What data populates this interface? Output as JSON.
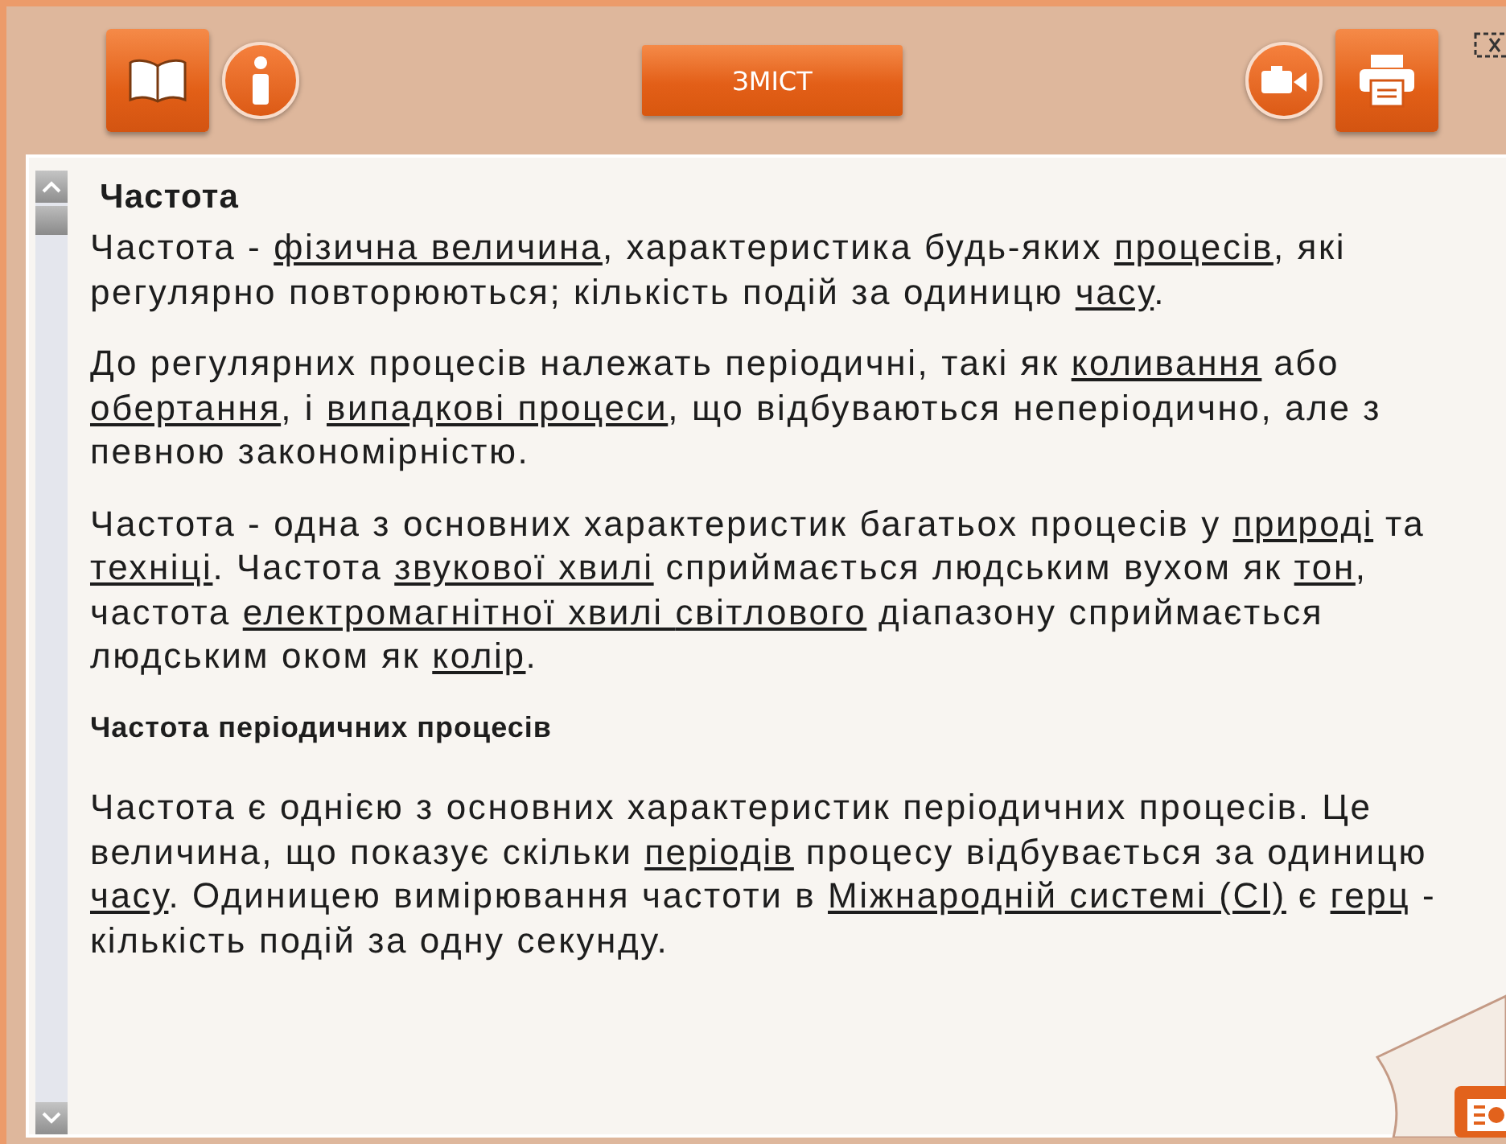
{
  "toolbar": {
    "contents_button": "ЗМІСТ"
  },
  "article": {
    "title": "Частота",
    "blocks": [
      {
        "kind": "paragraph",
        "segments": [
          {
            "kind": "text",
            "text": "Частота - "
          },
          {
            "kind": "link",
            "text": "фізична величина"
          },
          {
            "kind": "text",
            "text": ", характеристика будь-яких "
          },
          {
            "kind": "link",
            "text": "процесів"
          },
          {
            "kind": "text",
            "text": ", які регулярно повторюються; кількість подій за одиницю "
          },
          {
            "kind": "link",
            "text": "часу"
          },
          {
            "kind": "text",
            "text": "."
          }
        ]
      },
      {
        "kind": "paragraph",
        "segments": [
          {
            "kind": "text",
            "text": "До регулярних процесів належать періодичні, такі як "
          },
          {
            "kind": "link",
            "text": "коливання"
          },
          {
            "kind": "text",
            "text": " або "
          },
          {
            "kind": "link",
            "text": "обертання"
          },
          {
            "kind": "text",
            "text": ", і "
          },
          {
            "kind": "link",
            "text": "випадкові процеси"
          },
          {
            "kind": "text",
            "text": ", що відбуваються неперіодично, але з певною закономірністю."
          }
        ]
      },
      {
        "kind": "paragraph",
        "segments": [
          {
            "kind": "text",
            "text": "Частота - одна з основних характеристик багатьох процесів у "
          },
          {
            "kind": "link",
            "text": "природі"
          },
          {
            "kind": "text",
            "text": " та "
          },
          {
            "kind": "link",
            "text": "техніці"
          },
          {
            "kind": "text",
            "text": ". Частота "
          },
          {
            "kind": "link",
            "text": "звукової хвилі"
          },
          {
            "kind": "text",
            "text": " сприймається людським вухом як "
          },
          {
            "kind": "link",
            "text": "тон"
          },
          {
            "kind": "text",
            "text": ", частота "
          },
          {
            "kind": "link",
            "text": "електромагнітної хвилі "
          },
          {
            "kind": "link",
            "text": "світлового"
          },
          {
            "kind": "text",
            "text": " діапазону сприймається людським оком як "
          },
          {
            "kind": "link",
            "text": "колір"
          },
          {
            "kind": "text",
            "text": "."
          }
        ]
      },
      {
        "kind": "heading",
        "segments": [
          {
            "kind": "text",
            "text": "Частота періодичних процесів"
          }
        ]
      },
      {
        "kind": "paragraph",
        "segments": [
          {
            "kind": "text",
            "text": "Частота є однією з основних характеристик періодичних процесів. Це величина, що показує скільки "
          },
          {
            "kind": "link",
            "text": "періодів"
          },
          {
            "kind": "text",
            "text": " процесу відбувається за одиницю "
          },
          {
            "kind": "link",
            "text": "часу"
          },
          {
            "kind": "text",
            "text": ". Одиницею вимірювання частоти в "
          },
          {
            "kind": "link",
            "text": "Міжнародній системі (СІ)"
          },
          {
            "kind": "text",
            "text": " є "
          },
          {
            "kind": "link",
            "text": "герц"
          },
          {
            "kind": "text",
            "text": " - кількість подій за одну секунду."
          }
        ]
      }
    ]
  }
}
